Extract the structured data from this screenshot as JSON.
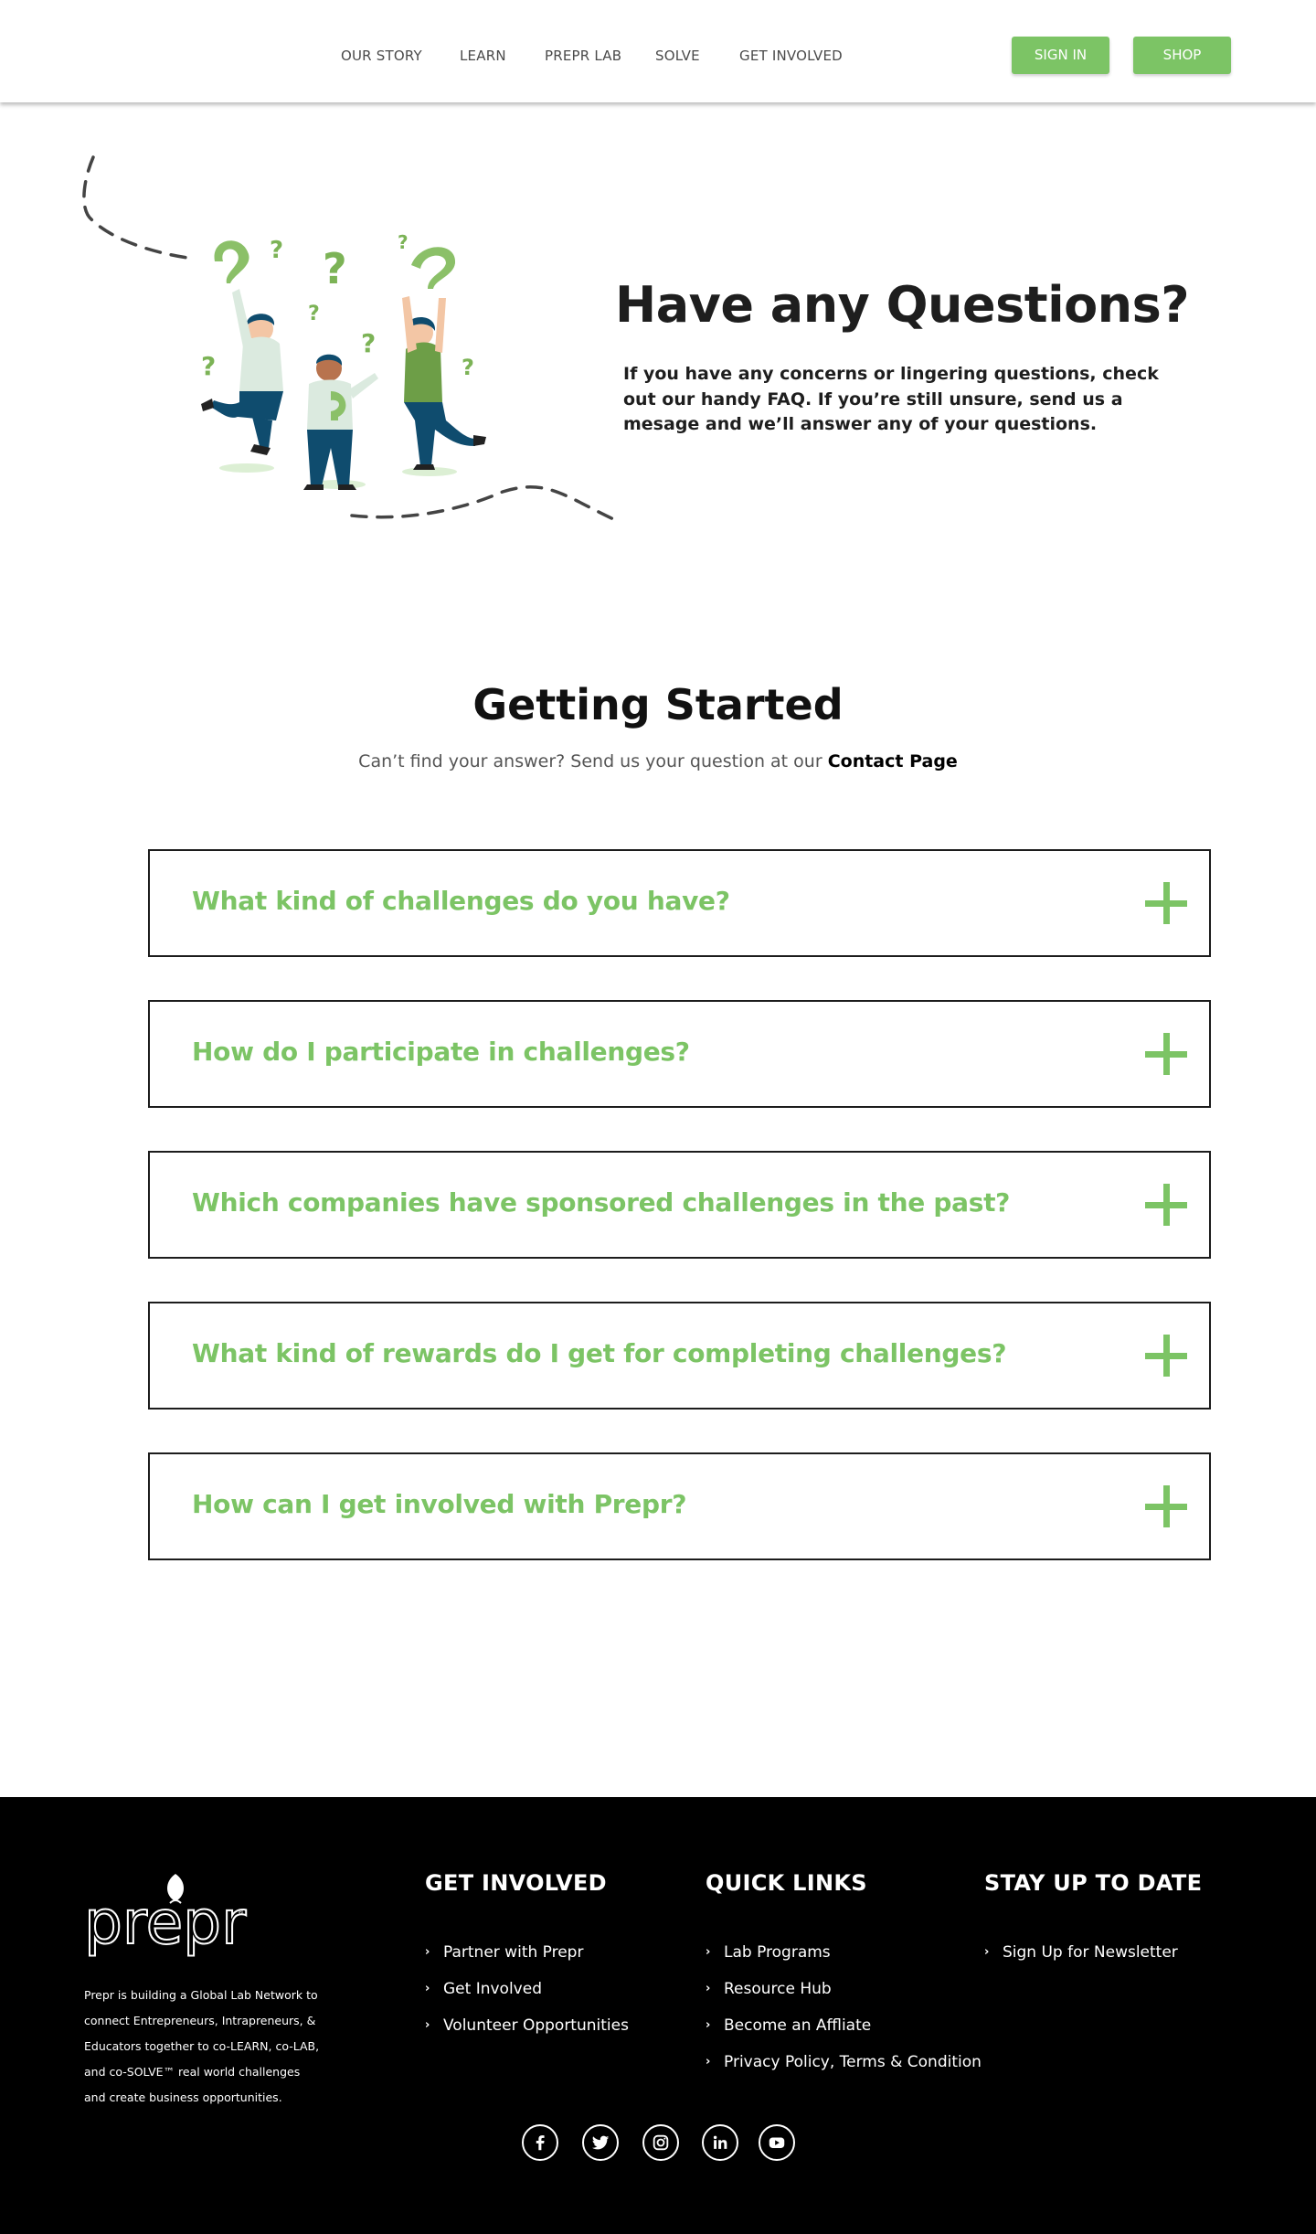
{
  "header": {
    "nav": [
      {
        "label": "OUR STORY"
      },
      {
        "label": "LEARN"
      },
      {
        "label": "PREPR LAB"
      },
      {
        "label": "SOLVE"
      },
      {
        "label": "GET INVOLVED"
      }
    ],
    "sign_in_label": "SIGN IN",
    "shop_label": "SHOP"
  },
  "hero": {
    "title": "Have any Questions?",
    "text": "If you have any concerns or lingering questions, check out our handy FAQ. If you’re still unsure, send us a mesage and we’ll answer any of your questions."
  },
  "getting_started": {
    "title": "Getting Started",
    "subtitle": "Can’t find your answer? Send us your question at our",
    "contact_link": "Contact Page"
  },
  "faqs": [
    {
      "question": "What kind of challenges do you have?"
    },
    {
      "question": "How do I participate in challenges?"
    },
    {
      "question": "Which companies have sponsored challenges in the past?"
    },
    {
      "question": "What kind of rewards do I get for completing challenges?"
    },
    {
      "question": "How can I get involved with Prepr?"
    }
  ],
  "footer": {
    "logo_text": "prepr",
    "about": "Prepr is building a Global Lab Network to connect Entrepreneurs, Intrapreneurs, & Educators together to co-LEARN, co-LAB, and co-SOLVE™ real world challenges and create business opportunities.",
    "columns": [
      {
        "title": "GET INVOLVED",
        "links": [
          "Partner with Prepr",
          "Get Involved",
          "Volunteer Opportunities"
        ]
      },
      {
        "title": "QUICK LINKS",
        "links": [
          "Lab Programs",
          "Resource Hub",
          "Become an Affliate",
          "Privacy Policy, Terms & Condition"
        ]
      },
      {
        "title": "STAY UP TO DATE",
        "links": [
          "Sign Up for Newsletter"
        ]
      }
    ],
    "social_icons": [
      "facebook-icon",
      "twitter-icon",
      "instagram-icon",
      "linkedin-icon",
      "youtube-icon"
    ]
  },
  "colors": {
    "accent": "#7cc465",
    "footer_bg": "#000000"
  }
}
